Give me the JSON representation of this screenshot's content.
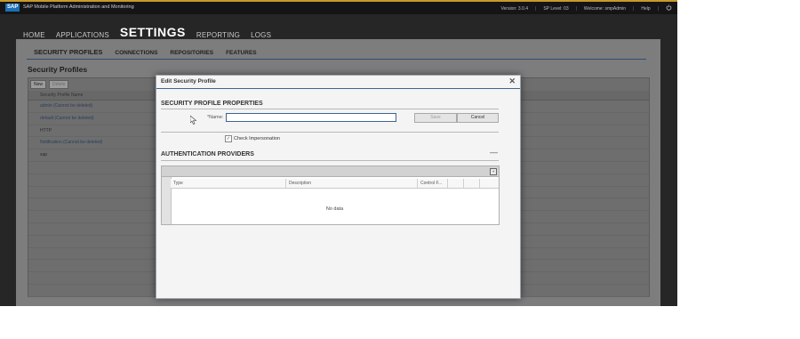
{
  "shell": {
    "logo": "SAP",
    "title": "SAP Mobile Platform Administration and Monitoring",
    "version": "Version: 3.0.4",
    "sp_level": "SP Level: 03",
    "welcome": "Welcome: smpAdmin",
    "help": "Help",
    "separator": "|"
  },
  "main_nav": {
    "items": [
      "HOME",
      "APPLICATIONS",
      "SETTINGS",
      "REPORTING",
      "LOGS"
    ]
  },
  "sub_nav": {
    "items": [
      "SECURITY PROFILES",
      "CONNECTIONS",
      "REPOSITORIES",
      "FEATURES"
    ]
  },
  "security_profiles": {
    "title": "Security Profiles",
    "new_label": "New",
    "delete_label": "Delete",
    "column_header": "Security Profile Name",
    "rows": [
      "admin (Cannot be deleted)",
      "default (Cannot be deleted)",
      "HTTP",
      "Notification (Cannot be deleted)",
      "sap"
    ]
  },
  "dialog": {
    "title": "Edit Security Profile",
    "close_glyph": "✕",
    "properties_heading": "SECURITY PROFILE PROPERTIES",
    "name_required": "*",
    "name_label": "Name:",
    "name_value": "",
    "save_label": "Save",
    "cancel_label": "Cancel",
    "check_impersonation_label": "Check Impersonation",
    "check_impersonation_checked": true,
    "providers_heading": "AUTHENTICATION PROVIDERS",
    "collapse_glyph": "—",
    "grid_columns": [
      "Type",
      "Description",
      "Control F...",
      "",
      ""
    ],
    "no_data": "No data"
  }
}
